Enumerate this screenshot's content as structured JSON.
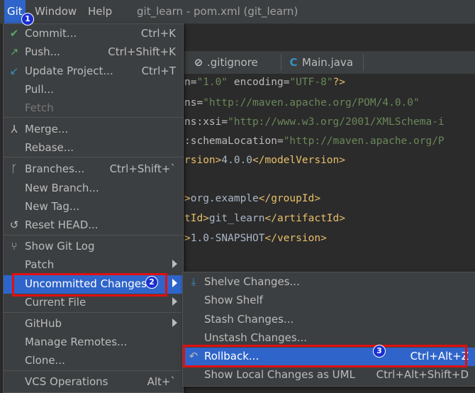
{
  "menubar": {
    "items": [
      "Git",
      "Window",
      "Help"
    ],
    "window_title": "git_learn - pom.xml (git_learn)"
  },
  "editor_tabs": [
    {
      "label": ".gitignore",
      "icon": "gitignore-file-icon"
    },
    {
      "label": "Main.java",
      "icon": "java-class-icon"
    }
  ],
  "code_lines": [
    {
      "parts": [
        [
          "attr",
          "n="
        ],
        [
          "str",
          "\"1.0\""
        ],
        [
          "attr",
          " encoding="
        ],
        [
          "str",
          "\"UTF-8\""
        ],
        [
          "pi",
          "?>"
        ]
      ]
    },
    {
      "parts": [
        [
          "attr",
          "ns="
        ],
        [
          "str",
          "\"http://maven.apache.org/POM/4.0.0\""
        ]
      ]
    },
    {
      "parts": [
        [
          "attr",
          "ns:xsi="
        ],
        [
          "str",
          "\"http://www.w3.org/2001/XMLSchema-i"
        ]
      ]
    },
    {
      "parts": [
        [
          "attr",
          ":schemaLocation="
        ],
        [
          "str",
          "\"http://maven.apache.org/P"
        ]
      ]
    },
    {
      "parts": [
        [
          "tag",
          "rsion>"
        ],
        [
          "text",
          "4.0.0"
        ],
        [
          "tag",
          "</modelVersion>"
        ]
      ]
    },
    {
      "parts": []
    },
    {
      "parts": [
        [
          "tag",
          ">"
        ],
        [
          "text",
          "org.example"
        ],
        [
          "tag",
          "</groupId>"
        ]
      ]
    },
    {
      "parts": [
        [
          "tag",
          "tId>"
        ],
        [
          "text",
          "git_learn"
        ],
        [
          "tag",
          "</artifactId>"
        ]
      ]
    },
    {
      "parts": [
        [
          "tag",
          ">"
        ],
        [
          "text",
          "1.0-SNAPSHOT"
        ],
        [
          "tag",
          "</version>"
        ]
      ]
    }
  ],
  "git_menu": {
    "items": [
      {
        "label": "Commit...",
        "shortcut": "Ctrl+K",
        "icon": "check-icon"
      },
      {
        "label": "Push...",
        "shortcut": "Ctrl+Shift+K",
        "icon": "push-arrow-icon"
      },
      {
        "label": "Update Project...",
        "shortcut": "Ctrl+T",
        "icon": "update-arrow-icon"
      },
      {
        "label": "Pull...",
        "shortcut": ""
      },
      {
        "label": "Fetch",
        "shortcut": "",
        "disabled": true
      },
      {
        "label": "Merge...",
        "shortcut": "",
        "icon": "merge-icon"
      },
      {
        "label": "Rebase...",
        "shortcut": ""
      },
      {
        "label": "Branches...",
        "shortcut": "Ctrl+Shift+`",
        "icon": "branch-icon"
      },
      {
        "label": "New Branch...",
        "shortcut": ""
      },
      {
        "label": "New Tag...",
        "shortcut": ""
      },
      {
        "label": "Reset HEAD...",
        "shortcut": "",
        "icon": "undo-icon"
      },
      {
        "label": "Show Git Log",
        "shortcut": "",
        "icon": "git-log-icon"
      },
      {
        "label": "Patch",
        "shortcut": "",
        "submenu": true
      },
      {
        "label": "Uncommitted Changes",
        "shortcut": "",
        "submenu": true,
        "highlighted": true
      },
      {
        "label": "Current File",
        "shortcut": "",
        "submenu": true
      },
      {
        "label": "GitHub",
        "shortcut": "",
        "submenu": true
      },
      {
        "label": "Manage Remotes...",
        "shortcut": ""
      },
      {
        "label": "Clone...",
        "shortcut": ""
      },
      {
        "label": "VCS Operations",
        "shortcut": "Alt+`"
      }
    ]
  },
  "submenu": {
    "items": [
      {
        "label": "Shelve Changes...",
        "shortcut": "",
        "icon": "shelve-icon"
      },
      {
        "label": "Show Shelf",
        "shortcut": ""
      },
      {
        "label": "Stash Changes...",
        "shortcut": ""
      },
      {
        "label": "Unstash Changes...",
        "shortcut": ""
      },
      {
        "label": "Rollback...",
        "shortcut": "Ctrl+Alt+Z",
        "icon": "rollback-icon",
        "highlighted": true
      },
      {
        "label": "Show Local Changes as UML",
        "shortcut": "Ctrl+Alt+Shift+D"
      }
    ]
  },
  "annotations": {
    "badges": [
      "1",
      "2",
      "3"
    ],
    "badge_color": "#1a2fd0",
    "box_color": "#e01010"
  },
  "colors": {
    "menu_bg": "#3c3f41",
    "highlight": "#2f65ca",
    "editor_bg": "#2b2b2b"
  }
}
